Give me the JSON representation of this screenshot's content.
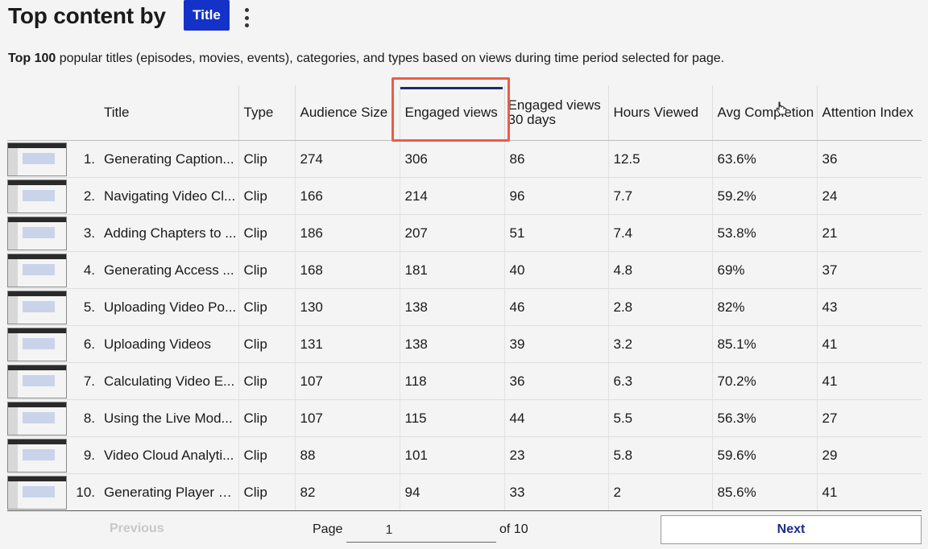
{
  "header": {
    "title": "Top content by",
    "dimension_button": "Title"
  },
  "description": {
    "bold": "Top 100",
    "rest": " popular titles (episodes, movies, events), categories, and types based on views during time period selected for page."
  },
  "table": {
    "columns": [
      "",
      "",
      "Title",
      "Type",
      "Audience Size",
      "Engaged views",
      "Engaged views 30 days",
      "Hours Viewed",
      "Avg Completion",
      "Attention Index"
    ],
    "sorted_column": "Engaged views",
    "rows": [
      {
        "rank": "1.",
        "title": "Generating Caption...",
        "type": "Clip",
        "audience": "274",
        "engaged": "306",
        "engaged30": "86",
        "hours": "12.5",
        "completion": "63.6%",
        "attention": "36"
      },
      {
        "rank": "2.",
        "title": "Navigating Video Cl...",
        "type": "Clip",
        "audience": "166",
        "engaged": "214",
        "engaged30": "96",
        "hours": "7.7",
        "completion": "59.2%",
        "attention": "24"
      },
      {
        "rank": "3.",
        "title": "Adding Chapters to ...",
        "type": "Clip",
        "audience": "186",
        "engaged": "207",
        "engaged30": "51",
        "hours": "7.4",
        "completion": "53.8%",
        "attention": "21"
      },
      {
        "rank": "4.",
        "title": "Generating Access ...",
        "type": "Clip",
        "audience": "168",
        "engaged": "181",
        "engaged30": "40",
        "hours": "4.8",
        "completion": "69%",
        "attention": "37"
      },
      {
        "rank": "5.",
        "title": "Uploading Video Po...",
        "type": "Clip",
        "audience": "130",
        "engaged": "138",
        "engaged30": "46",
        "hours": "2.8",
        "completion": "82%",
        "attention": "43"
      },
      {
        "rank": "6.",
        "title": "Uploading Videos",
        "type": "Clip",
        "audience": "131",
        "engaged": "138",
        "engaged30": "39",
        "hours": "3.2",
        "completion": "85.1%",
        "attention": "41"
      },
      {
        "rank": "7.",
        "title": "Calculating Video E...",
        "type": "Clip",
        "audience": "107",
        "engaged": "118",
        "engaged30": "36",
        "hours": "6.3",
        "completion": "70.2%",
        "attention": "41"
      },
      {
        "rank": "8.",
        "title": "Using the Live Mod...",
        "type": "Clip",
        "audience": "107",
        "engaged": "115",
        "engaged30": "44",
        "hours": "5.5",
        "completion": "56.3%",
        "attention": "27"
      },
      {
        "rank": "9.",
        "title": "Video Cloud Analyti...",
        "type": "Clip",
        "audience": "88",
        "engaged": "101",
        "engaged30": "23",
        "hours": "5.8",
        "completion": "59.6%",
        "attention": "29"
      },
      {
        "rank": "10.",
        "title": "Generating Player C...",
        "type": "Clip",
        "audience": "82",
        "engaged": "94",
        "engaged30": "33",
        "hours": "2",
        "completion": "85.6%",
        "attention": "41"
      }
    ]
  },
  "pagination": {
    "previous": "Previous",
    "page_label": "Page",
    "current_page": "1",
    "of_label": "of 10",
    "next": "Next"
  },
  "colors": {
    "accent": "#1432c8",
    "highlight": "#ec5b4b",
    "next_text": "#1a2d8a"
  }
}
